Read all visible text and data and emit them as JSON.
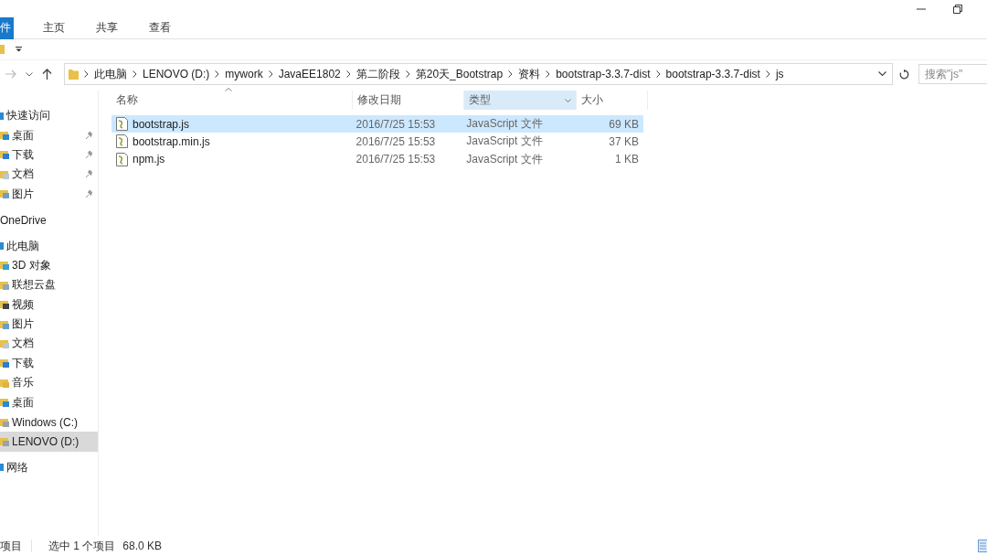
{
  "ribbon": {
    "tabs": [
      {
        "label": "件",
        "selected": true
      },
      {
        "label": "主页",
        "selected": false
      },
      {
        "label": "共享",
        "selected": false
      },
      {
        "label": "查看",
        "selected": false
      }
    ]
  },
  "address": {
    "crumbs": [
      "此电脑",
      "LENOVO (D:)",
      "mywork",
      "JavaEE1802",
      "第二阶段",
      "第20天_Bootstrap",
      "资料",
      "bootstrap-3.3.7-dist",
      "bootstrap-3.3.7-dist",
      "js"
    ],
    "search_placeholder": "搜索\"js\""
  },
  "nav": [
    {
      "label": "快速访问",
      "kind": "star",
      "selected": false,
      "children": [
        {
          "label": "桌面",
          "kind": "desktop",
          "pinned": true,
          "selected": false
        },
        {
          "label": "下载",
          "kind": "download",
          "pinned": true,
          "selected": false
        },
        {
          "label": "文档",
          "kind": "document",
          "pinned": true,
          "selected": false
        },
        {
          "label": "图片",
          "kind": "pictures",
          "pinned": true,
          "selected": false
        }
      ]
    },
    {
      "label": "OneDrive",
      "kind": "none",
      "selected": false
    },
    {
      "label": "此电脑",
      "kind": "computer",
      "selected": false,
      "children": [
        {
          "label": "3D 对象",
          "kind": "objects",
          "selected": false
        },
        {
          "label": "联想云盘",
          "kind": "cloud",
          "selected": false
        },
        {
          "label": "视频",
          "kind": "video",
          "selected": false
        },
        {
          "label": "图片",
          "kind": "pictures",
          "selected": false
        },
        {
          "label": "文档",
          "kind": "document",
          "selected": false
        },
        {
          "label": "下载",
          "kind": "download",
          "selected": false
        },
        {
          "label": "音乐",
          "kind": "music",
          "selected": false
        },
        {
          "label": "桌面",
          "kind": "desktop",
          "selected": false
        },
        {
          "label": "Windows (C:)",
          "kind": "drive",
          "selected": false
        },
        {
          "label": "LENOVO (D:)",
          "kind": "drive",
          "selected": true
        }
      ]
    },
    {
      "label": "网络",
      "kind": "network",
      "selected": false
    }
  ],
  "columns": [
    {
      "label": "名称",
      "highlighted": false,
      "sorted": true
    },
    {
      "label": "修改日期",
      "highlighted": false,
      "sorted": false
    },
    {
      "label": "类型",
      "highlighted": true,
      "sorted": false
    },
    {
      "label": "大小",
      "highlighted": false,
      "sorted": false
    }
  ],
  "files": [
    {
      "name": "bootstrap.js",
      "date": "2016/7/25 15:53",
      "type": "JavaScript 文件",
      "size": "69 KB",
      "selected": true
    },
    {
      "name": "bootstrap.min.js",
      "date": "2016/7/25 15:53",
      "type": "JavaScript 文件",
      "size": "37 KB",
      "selected": false
    },
    {
      "name": "npm.js",
      "date": "2016/7/25 15:53",
      "type": "JavaScript 文件",
      "size": "1 KB",
      "selected": false
    }
  ],
  "status_bar": {
    "items": "项目",
    "selection": "选中 1 个项目",
    "selection_size": "68.0 KB"
  }
}
